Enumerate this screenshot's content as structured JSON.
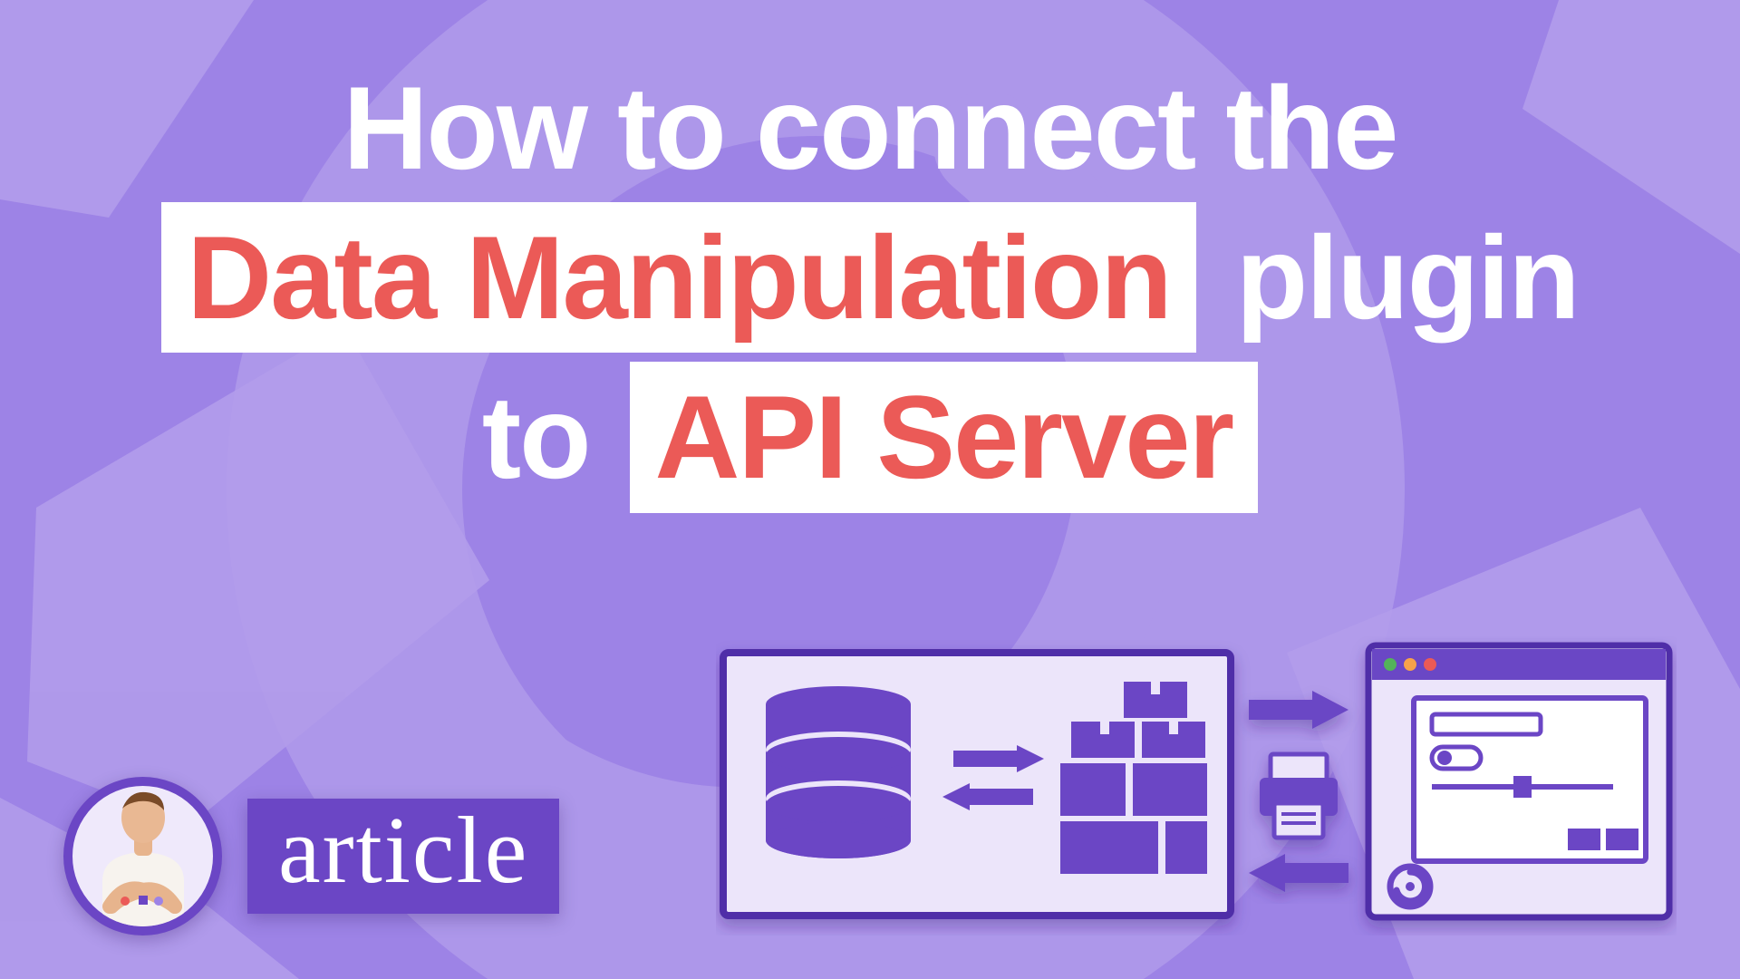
{
  "colors": {
    "bg": "#9d83e6",
    "bgLight": "#b29ceb",
    "purple": "#6b46c5",
    "purpleDark": "#4f2ea8",
    "white": "#ffffff",
    "panel": "#ece5fa",
    "red": "#eb5a57",
    "green": "#52b35a",
    "orange": "#f7a24a"
  },
  "title": {
    "line1": "How to connect the",
    "line2_boxed": "Data Manipulation",
    "line2_tail": "plugin",
    "line3_head": "to",
    "line3_boxed": "API Server"
  },
  "badge": {
    "label": "article"
  },
  "icons": {
    "avatar": "author-avatar",
    "database": "database-icon",
    "blocks": "blocks-icon",
    "browser": "browser-window-icon",
    "form": "form-panel-icon",
    "printer": "printer-icon",
    "arrow_right": "arrow-right-icon",
    "arrow_left": "arrow-left-icon",
    "swap": "swap-arrows-icon",
    "swirl": "swirl-logo-icon"
  }
}
